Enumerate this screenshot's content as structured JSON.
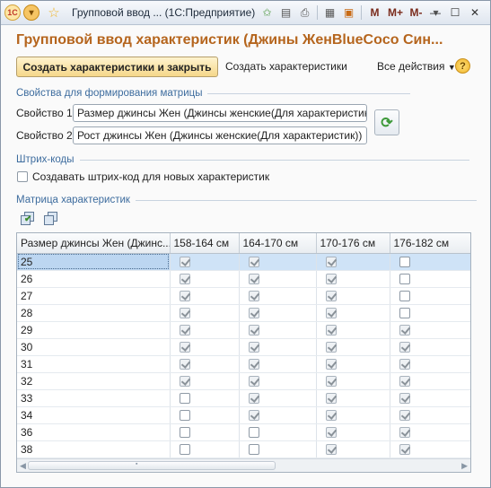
{
  "titlebar": {
    "app_badge": "1C",
    "title": "Групповой ввод ...  (1С:Предприятие)",
    "memory_labels": [
      "M",
      "M+",
      "M-"
    ]
  },
  "form": {
    "heading": "Групповой ввод характеристик (Джины ЖенBlueCoco Син...",
    "create_and_close": "Создать характеристики и закрыть",
    "create": "Создать характеристики",
    "all_actions": "Все действия",
    "help": "?"
  },
  "matrix_props": {
    "group_title": "Свойства для формирования матрицы",
    "prop1_label": "Свойство 1:",
    "prop1_value": "Размер джинсы Жен (Джинсы женские(Для характеристик))",
    "prop2_label": "Свойство 2:",
    "prop2_value": "Рост джинсы Жен (Джинсы женские(Для характеристик))"
  },
  "barcodes": {
    "group_title": "Штрих-коды",
    "create_barcodes_label": "Создавать штрих-код для новых характеристик",
    "create_barcodes_checked": false
  },
  "matrix": {
    "group_title": "Матрица характеристик",
    "columns": [
      "Размер джинсы Жен (Джинс...",
      "158-164 см",
      "164-170 см",
      "170-176 см",
      "176-182 см"
    ],
    "rows": [
      {
        "size": "25",
        "checks": [
          true,
          true,
          true,
          false
        ],
        "selected": true
      },
      {
        "size": "26",
        "checks": [
          true,
          true,
          true,
          false
        ]
      },
      {
        "size": "27",
        "checks": [
          true,
          true,
          true,
          false
        ]
      },
      {
        "size": "28",
        "checks": [
          true,
          true,
          true,
          false
        ]
      },
      {
        "size": "29",
        "checks": [
          true,
          true,
          true,
          true
        ]
      },
      {
        "size": "30",
        "checks": [
          true,
          true,
          true,
          true
        ]
      },
      {
        "size": "31",
        "checks": [
          true,
          true,
          true,
          true
        ]
      },
      {
        "size": "32",
        "checks": [
          true,
          true,
          true,
          true
        ]
      },
      {
        "size": "33",
        "checks": [
          false,
          true,
          true,
          true
        ]
      },
      {
        "size": "34",
        "checks": [
          false,
          true,
          true,
          true
        ]
      },
      {
        "size": "36",
        "checks": [
          false,
          false,
          true,
          true
        ]
      },
      {
        "size": "38",
        "checks": [
          false,
          false,
          true,
          true
        ]
      }
    ]
  }
}
